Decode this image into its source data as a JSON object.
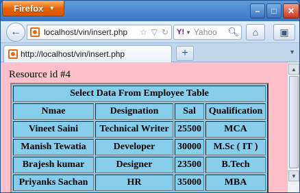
{
  "browser": {
    "app_button": "Firefox",
    "controls": {
      "minimize": "–",
      "maximize": "□",
      "close": "✕"
    }
  },
  "navbar": {
    "url": "localhost/vin/insert.php",
    "search_placeholder": "Yahoo",
    "search_engine": "Y!"
  },
  "tab": {
    "title": "http://localhost/vin/insert.php",
    "new_tab": "+"
  },
  "page": {
    "resource_text": "Resource id #4",
    "table": {
      "caption": "Select Data From Employee Table",
      "headers": [
        "Nmae",
        "Designation",
        "Sal",
        "Qualification"
      ],
      "rows": [
        [
          "Vineet Saini",
          "Technical Writer",
          "25500",
          "MCA"
        ],
        [
          "Manish Tewatia",
          "Developer",
          "30000",
          "M.Sc ( IT )"
        ],
        [
          "Brajesh kumar",
          "Designer",
          "23500",
          "B.Tech"
        ],
        [
          "Priyanks Sachan",
          "HR",
          "35000",
          "MBA"
        ]
      ]
    }
  },
  "colors": {
    "page_background": "#ffc0cb",
    "table_background": "#87ceeb",
    "firefox_orange": "#e66000"
  }
}
